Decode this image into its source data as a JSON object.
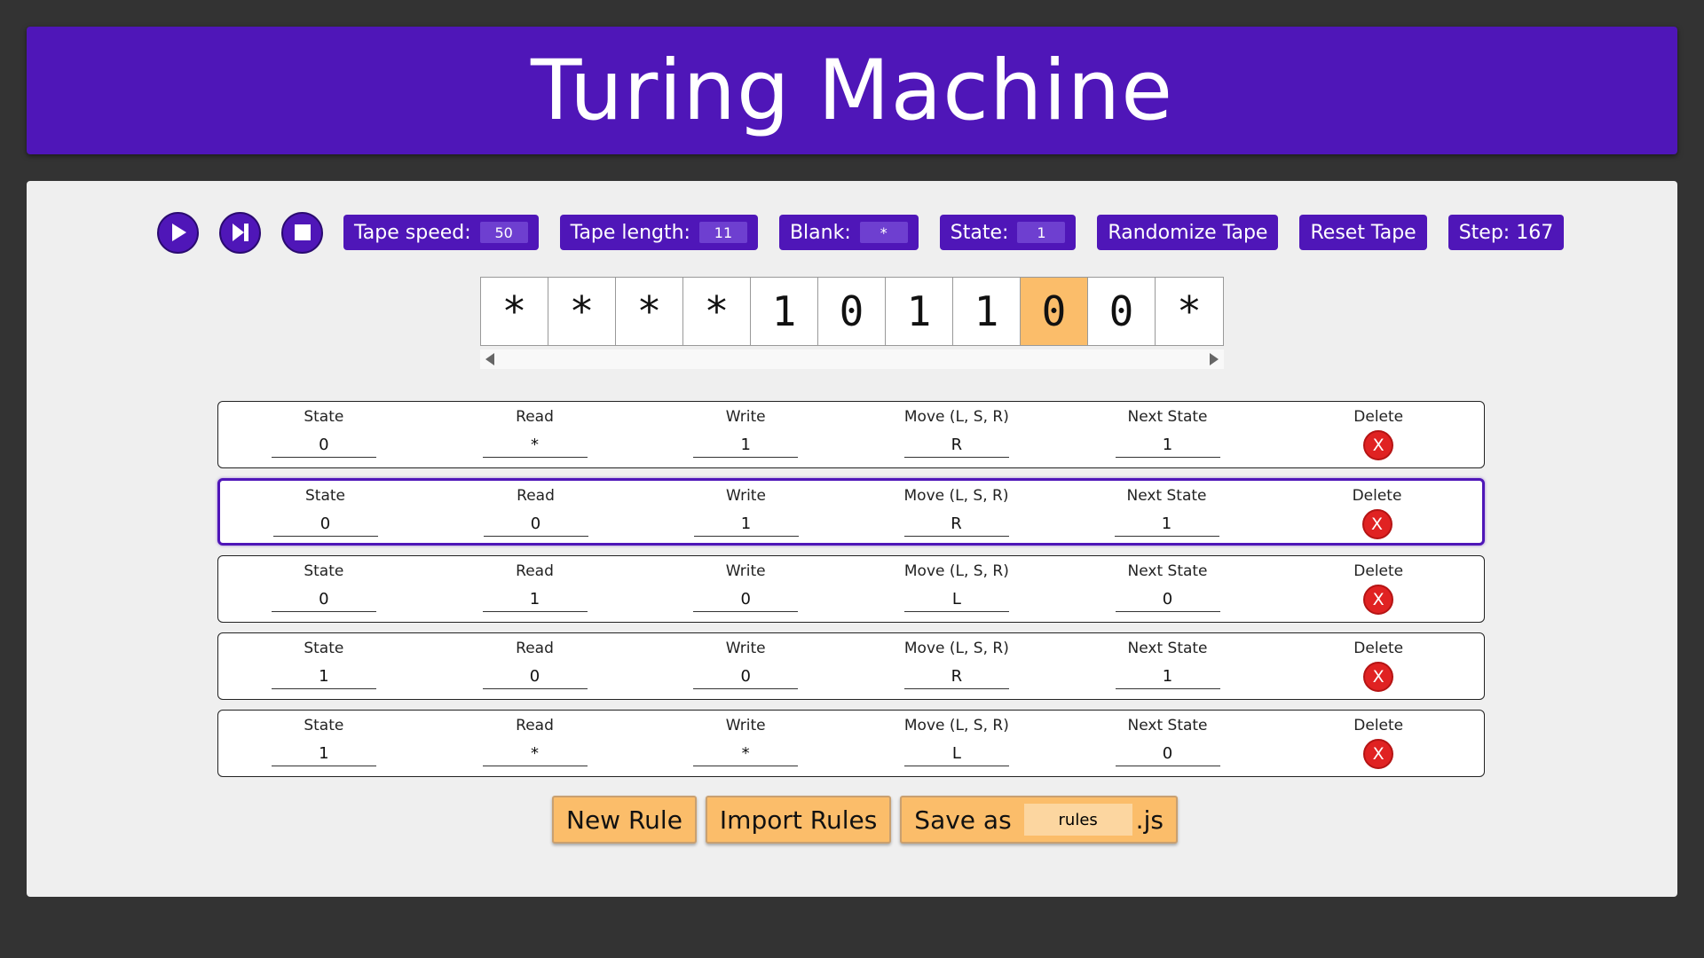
{
  "header": {
    "title": "Turing Machine"
  },
  "toolbar": {
    "tape_speed_label": "Tape speed:",
    "tape_speed_value": "50",
    "tape_length_label": "Tape length:",
    "tape_length_value": "11",
    "blank_label": "Blank:",
    "blank_value": "*",
    "state_label": "State:",
    "state_value": "1",
    "randomize_label": "Randomize Tape",
    "reset_label": "Reset Tape",
    "step_text": "Step: 167"
  },
  "tape": {
    "cells": [
      "*",
      "*",
      "*",
      "*",
      "1",
      "0",
      "1",
      "1",
      "0",
      "0",
      "*"
    ],
    "head_index": 8,
    "head_color": "#fbbd6a"
  },
  "rules": {
    "labels": {
      "state": "State",
      "read": "Read",
      "write": "Write",
      "move": "Move (L, S, R)",
      "next": "Next State",
      "delete": "Delete",
      "delete_glyph": "X"
    },
    "items": [
      {
        "state": "0",
        "read": "*",
        "write": "1",
        "move": "R",
        "next": "1",
        "selected": false
      },
      {
        "state": "0",
        "read": "0",
        "write": "1",
        "move": "R",
        "next": "1",
        "selected": true
      },
      {
        "state": "0",
        "read": "1",
        "write": "0",
        "move": "L",
        "next": "0",
        "selected": false
      },
      {
        "state": "1",
        "read": "0",
        "write": "0",
        "move": "R",
        "next": "1",
        "selected": false
      },
      {
        "state": "1",
        "read": "*",
        "write": "*",
        "move": "L",
        "next": "0",
        "selected": false
      }
    ]
  },
  "bottom": {
    "new_rule_label": "New Rule",
    "import_label": "Import Rules",
    "save_prefix": "Save as",
    "save_filename": "rules",
    "save_suffix": ".js"
  },
  "colors": {
    "accent": "#4f16b8",
    "orange": "#fbbd6a",
    "delete_red": "#e02222",
    "background": "#333333",
    "panel": "#efefef"
  },
  "icons": [
    "play-icon",
    "step-forward-icon",
    "stop-icon"
  ]
}
